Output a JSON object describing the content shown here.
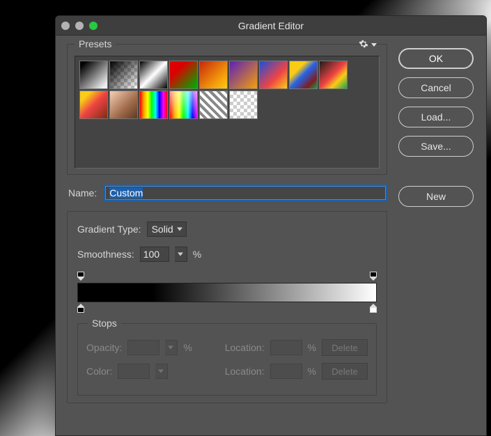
{
  "window": {
    "title": "Gradient Editor"
  },
  "buttons": {
    "ok": "OK",
    "cancel": "Cancel",
    "load": "Load...",
    "save": "Save...",
    "new_": "New"
  },
  "presets": {
    "label": "Presets"
  },
  "name": {
    "label": "Name:",
    "value": "Custom"
  },
  "gradientType": {
    "label": "Gradient Type:",
    "value": "Solid"
  },
  "smoothness": {
    "label": "Smoothness:",
    "value": "100",
    "unit": "%"
  },
  "stops": {
    "label": "Stops",
    "opacity_label": "Opacity:",
    "opacity_unit": "%",
    "location_label": "Location:",
    "location_unit": "%",
    "color_label": "Color:",
    "delete_label": "Delete"
  },
  "chart_data": {
    "type": "gradient",
    "opacity_stops": [
      {
        "location": 0,
        "opacity": 100
      },
      {
        "location": 100,
        "opacity": 100
      }
    ],
    "color_stops": [
      {
        "location": 0,
        "color": "#000000"
      },
      {
        "location": 100,
        "color": "#ffffff"
      }
    ]
  }
}
